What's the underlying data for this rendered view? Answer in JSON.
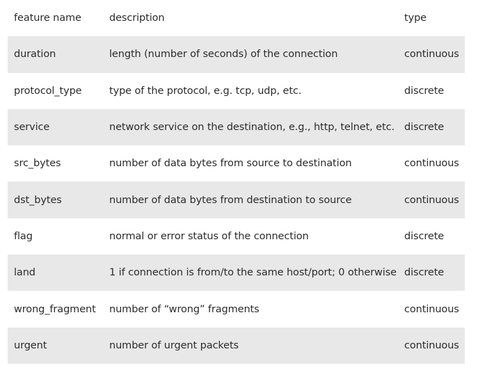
{
  "table": {
    "headers": {
      "name": "feature name",
      "description": "description",
      "type": "type"
    },
    "rows": [
      {
        "name": "duration",
        "description": "length (number of seconds) of the connection",
        "type": "continuous"
      },
      {
        "name": "protocol_type",
        "description": "type of the protocol, e.g. tcp, udp, etc.",
        "type": "discrete"
      },
      {
        "name": "service",
        "description": "network service on the destination, e.g., http, telnet, etc.",
        "type": "discrete"
      },
      {
        "name": "src_bytes",
        "description": "number of data bytes from source to destination",
        "type": "continuous"
      },
      {
        "name": "dst_bytes",
        "description": "number of data bytes from destination to source",
        "type": "continuous"
      },
      {
        "name": "flag",
        "description": "normal or error status of the connection",
        "type": "discrete"
      },
      {
        "name": "land",
        "description": "1 if connection is from/to the same host/port; 0 otherwise",
        "type": "discrete"
      },
      {
        "name": "wrong_fragment",
        "description": "number of “wrong” fragments",
        "type": "continuous"
      },
      {
        "name": "urgent",
        "description": "number of urgent packets",
        "type": "continuous"
      }
    ]
  },
  "colors": {
    "shaded_row": "#e8e8e8",
    "text": "#2b2b2b"
  }
}
